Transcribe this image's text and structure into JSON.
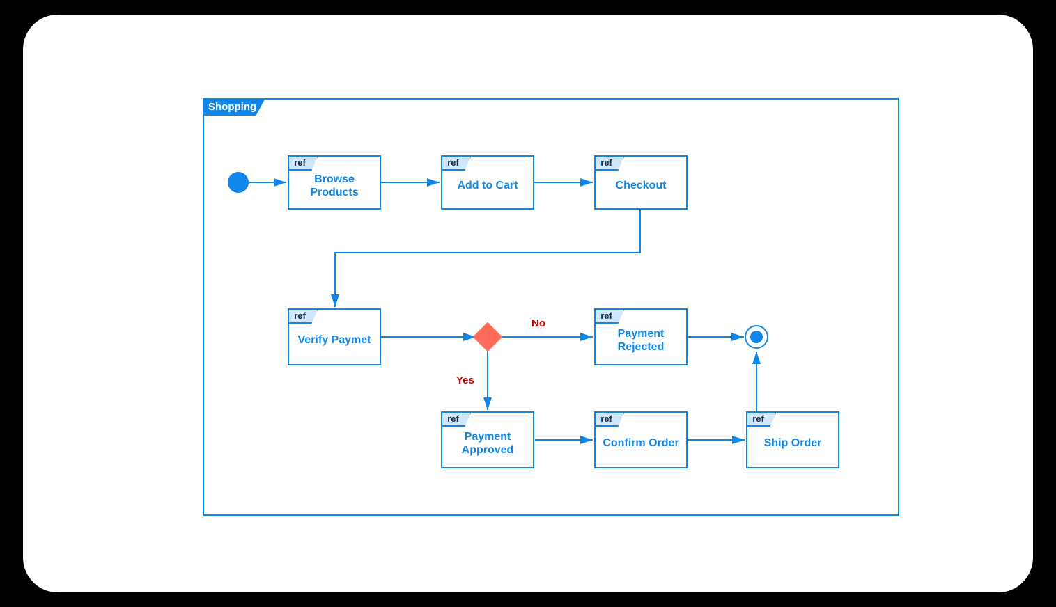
{
  "frame": {
    "title": "Shopping"
  },
  "refLabel": "ref",
  "nodes": {
    "browse": "Browse Products",
    "addToCart": "Add to Cart",
    "checkout": "Checkout",
    "verify": "Verify Paymet",
    "paymentRejected": "Payment Rejected",
    "paymentApproved": "Payment Approved",
    "confirmOrder": "Confirm Order",
    "shipOrder": "Ship Order"
  },
  "conditions": {
    "no": "No",
    "yes": "Yes"
  },
  "colors": {
    "primary": "#1086e8",
    "decisionFill": "#ff6b5b",
    "conditionText": "#d40000",
    "tabFill": "#cfe6fb"
  }
}
